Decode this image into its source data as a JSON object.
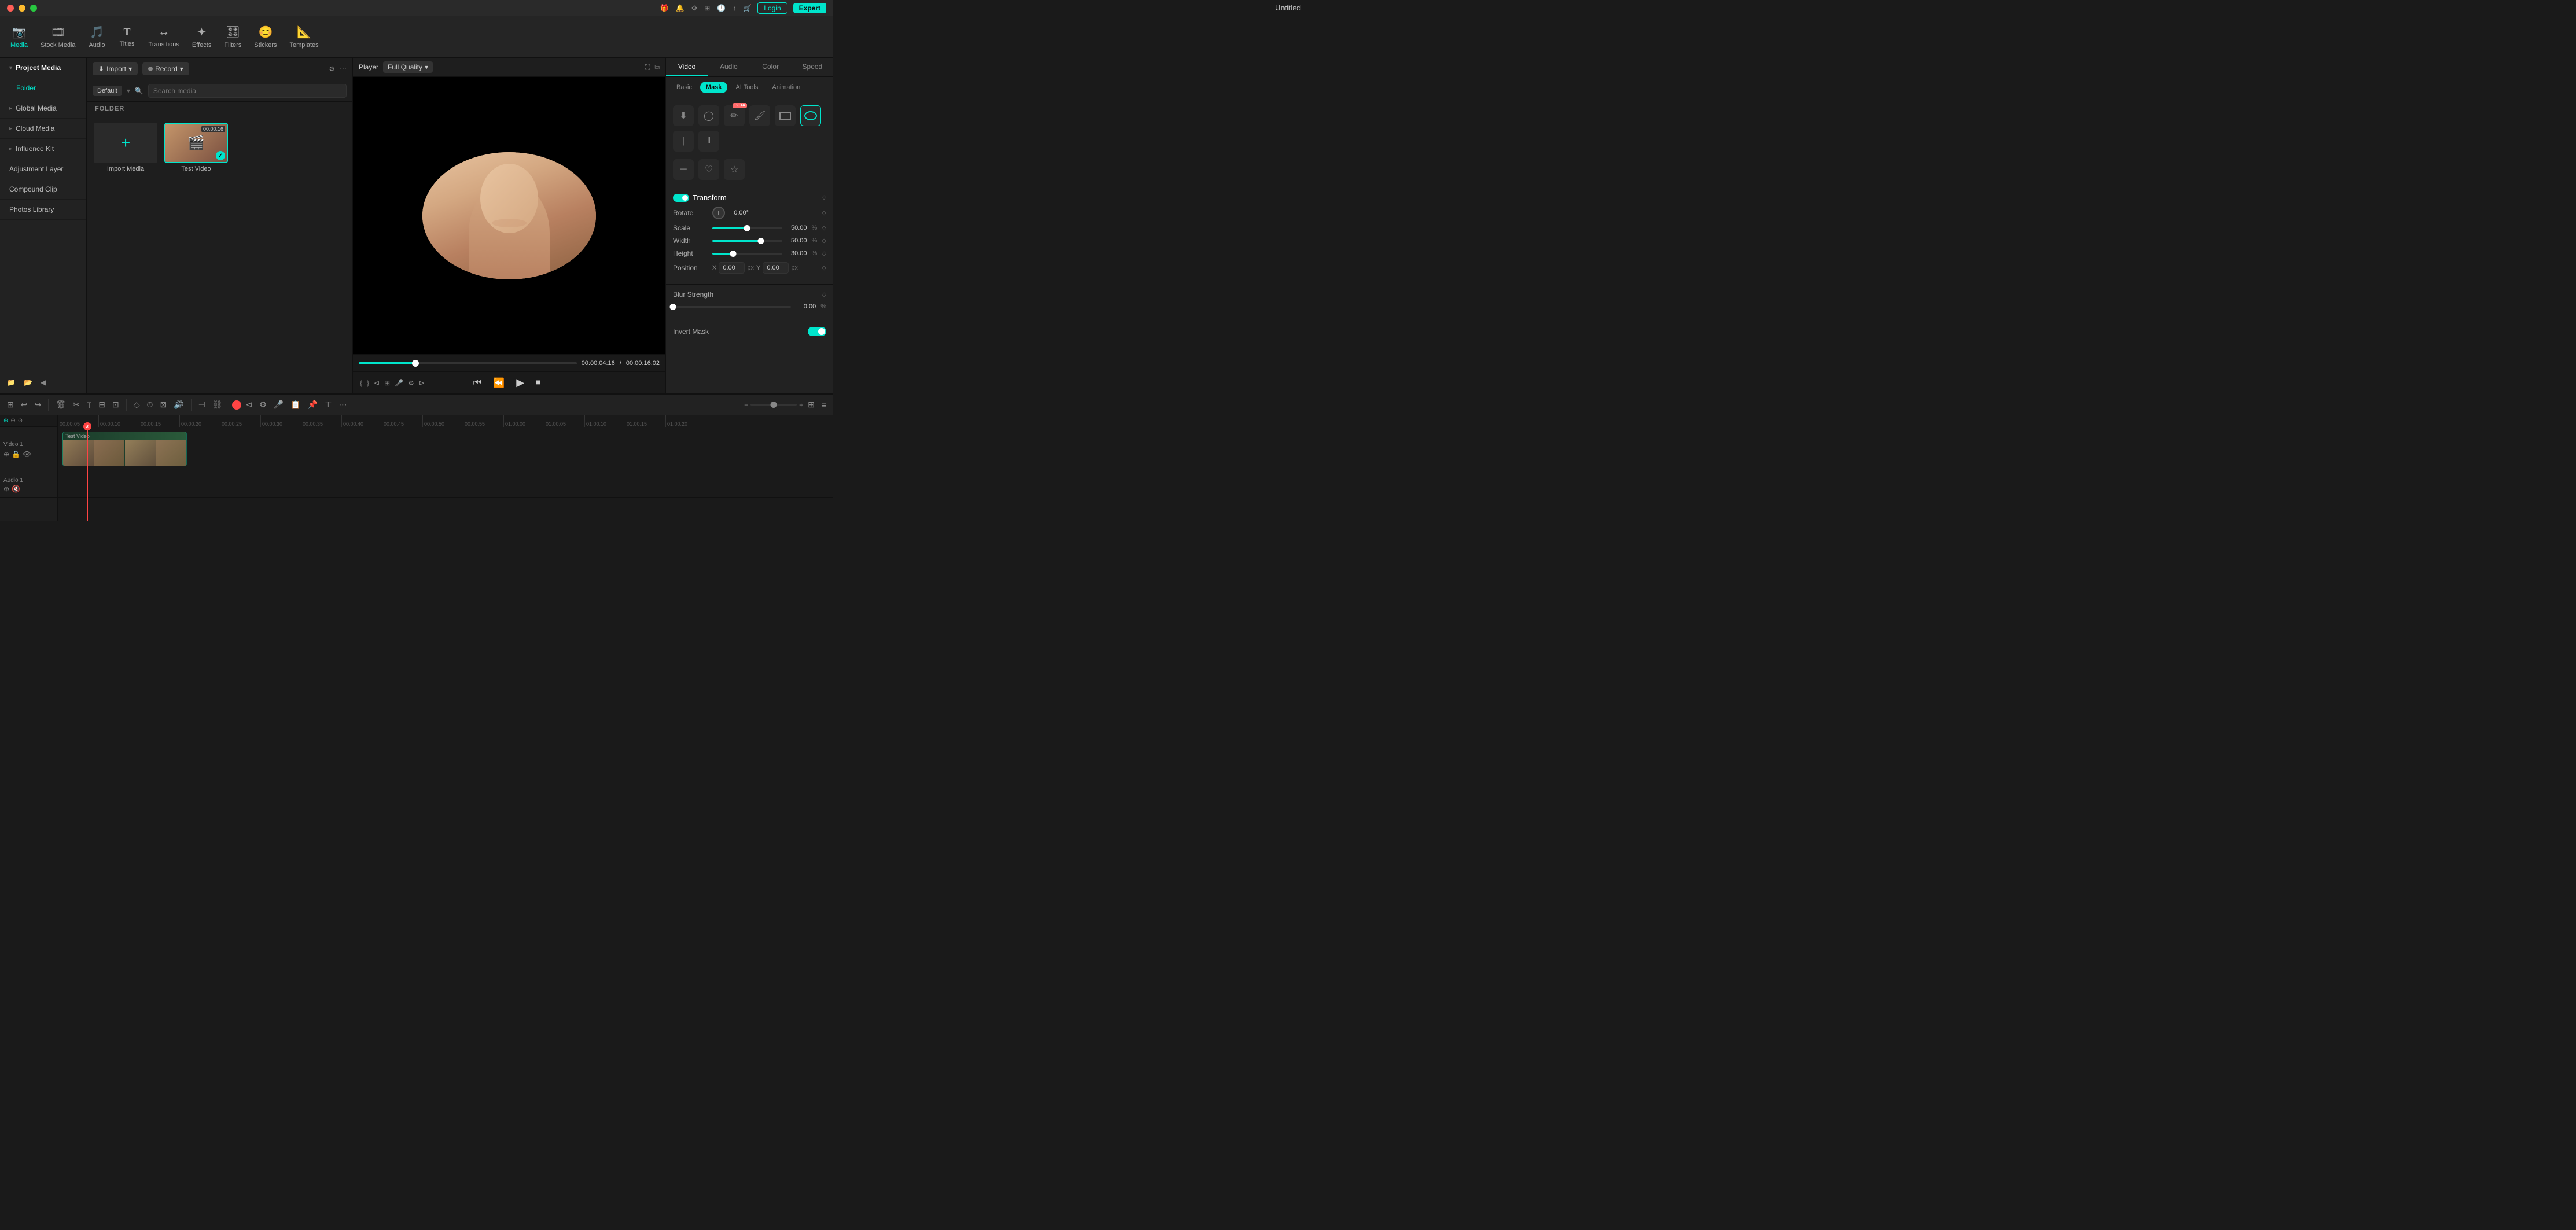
{
  "app": {
    "title": "Untitled",
    "window_controls": {
      "red": "close",
      "yellow": "minimize",
      "green": "fullscreen"
    }
  },
  "titlebar": {
    "title": "Untitled",
    "login_label": "Login",
    "expert_label": "Expert",
    "icons": [
      "gift-icon",
      "notification-icon",
      "settings-icon",
      "grid-icon",
      "clock-icon",
      "share-icon",
      "shopping-icon"
    ]
  },
  "toolbar": {
    "items": [
      {
        "id": "media",
        "icon": "📷",
        "label": "Media",
        "active": true
      },
      {
        "id": "stock",
        "icon": "🎞",
        "label": "Stock Media",
        "active": false
      },
      {
        "id": "audio",
        "icon": "🎵",
        "label": "Audio",
        "active": false
      },
      {
        "id": "titles",
        "icon": "T",
        "label": "Titles",
        "active": false
      },
      {
        "id": "transitions",
        "icon": "↔",
        "label": "Transitions",
        "active": false
      },
      {
        "id": "effects",
        "icon": "✨",
        "label": "Effects",
        "active": false
      },
      {
        "id": "filters",
        "icon": "🎛",
        "label": "Filters",
        "active": false
      },
      {
        "id": "stickers",
        "icon": "😊",
        "label": "Stickers",
        "active": false
      },
      {
        "id": "templates",
        "icon": "📐",
        "label": "Templates",
        "active": false
      }
    ]
  },
  "left_panel": {
    "items": [
      {
        "id": "project-media",
        "label": "Project Media",
        "active": true,
        "has_arrow": true
      },
      {
        "id": "folder",
        "label": "Folder",
        "is_folder": true
      },
      {
        "id": "global-media",
        "label": "Global Media",
        "has_arrow": true
      },
      {
        "id": "cloud-media",
        "label": "Cloud Media",
        "has_arrow": true
      },
      {
        "id": "influence-kit",
        "label": "Influence Kit",
        "has_arrow": true
      },
      {
        "id": "adjustment-layer",
        "label": "Adjustment Layer",
        "has_arrow": false
      },
      {
        "id": "compound-clip",
        "label": "Compound Clip",
        "has_arrow": false
      },
      {
        "id": "photos-library",
        "label": "Photos Library",
        "has_arrow": false
      }
    ]
  },
  "media_panel": {
    "import_label": "Import",
    "record_label": "Record",
    "folder_label": "FOLDER",
    "default_label": "Default",
    "search_placeholder": "Search media",
    "items": [
      {
        "id": "import-media",
        "type": "import",
        "name": "Import Media"
      },
      {
        "id": "test-video",
        "type": "video",
        "name": "Test Video",
        "badge": "00:00:16",
        "selected": true
      }
    ]
  },
  "player": {
    "label": "Player",
    "quality": "Full Quality",
    "current_time": "00:00:04:16",
    "total_time": "00:00:16:02",
    "progress_pct": 26
  },
  "right_panel": {
    "tabs": [
      "Video",
      "Audio",
      "Color",
      "Speed"
    ],
    "active_tab": "Video",
    "subtabs": [
      "Basic",
      "Mask",
      "AI Tools",
      "Animation"
    ],
    "active_subtab": "Mask",
    "mask_tools": [
      {
        "id": "download-mask",
        "icon": "⬇",
        "active": false
      },
      {
        "id": "circle-mask",
        "icon": "◯",
        "active": false
      },
      {
        "id": "pen-mask",
        "icon": "✏",
        "active": false,
        "beta": true
      },
      {
        "id": "brush-mask",
        "icon": "🖌",
        "active": false
      },
      {
        "id": "rectangle-mask",
        "icon": "▭",
        "active": false
      },
      {
        "id": "oval-mask",
        "icon": "⬭",
        "active": true
      }
    ],
    "mask_tools_row2": [
      {
        "id": "line-mask",
        "icon": "|",
        "active": false
      },
      {
        "id": "heart-mask",
        "icon": "♡",
        "active": false
      },
      {
        "id": "star-mask",
        "icon": "☆",
        "active": false
      }
    ],
    "transform": {
      "label": "Transform",
      "enabled": true
    },
    "rotate": {
      "label": "Rotate",
      "value": "0.00°"
    },
    "scale": {
      "label": "Scale",
      "value": "50.00",
      "unit": "%",
      "pct": 50
    },
    "width": {
      "label": "Width",
      "value": "50.00",
      "unit": "%",
      "pct": 70
    },
    "height": {
      "label": "Height",
      "value": "30.00",
      "unit": "%",
      "pct": 30
    },
    "position": {
      "label": "Position",
      "x_label": "X",
      "x_value": "0.00",
      "x_unit": "px",
      "y_label": "Y",
      "y_value": "0.00",
      "y_unit": "px"
    },
    "blur": {
      "label": "Blur Strength",
      "value": "0.00",
      "unit": "%",
      "pct": 0
    },
    "invert_mask": {
      "label": "Invert Mask",
      "enabled": true
    }
  },
  "timeline": {
    "ruler_marks": [
      "00:00:05:00",
      "00:00:10:00",
      "00:00:15:00",
      "00:00:20:00",
      "00:00:25:00",
      "00:00:30:00",
      "00:00:35:00",
      "00:00:40:00",
      "00:00:45:00",
      "00:00:50:00",
      "00:00:55:00",
      "01:00:00:00",
      "01:00:05:00",
      "01:00:10:00",
      "01:00:15:00",
      "01:00:20:00"
    ],
    "tracks": [
      {
        "id": "video-1",
        "label": "Video 1",
        "type": "video"
      },
      {
        "id": "audio-1",
        "label": "Audio 1",
        "type": "audio"
      }
    ],
    "playhead_pos": "120px",
    "video_clip_label": "Test Video"
  }
}
